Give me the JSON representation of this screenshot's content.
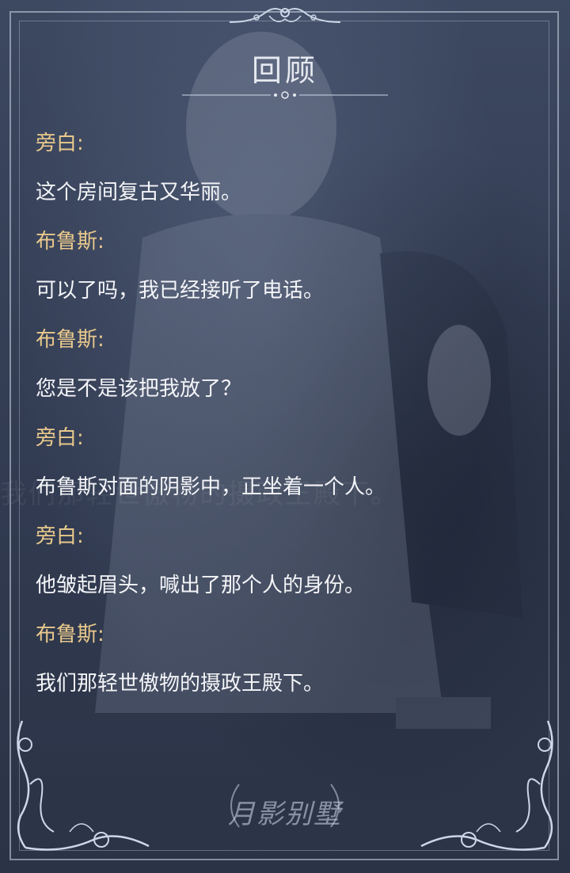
{
  "screen": {
    "title": "回顾"
  },
  "log": [
    {
      "speaker": "旁白:",
      "line": "这个房间复古又华丽。"
    },
    {
      "speaker": "布鲁斯:",
      "line": "可以了吗，我已经接听了电话。"
    },
    {
      "speaker": "布鲁斯:",
      "line": "您是不是该把我放了？"
    },
    {
      "speaker": "旁白:",
      "line": "布鲁斯对面的阴影中，正坐着一个人。"
    },
    {
      "speaker": "旁白:",
      "line": "他皱起眉头，喊出了那个人的身份。"
    },
    {
      "speaker": "布鲁斯:",
      "line": "我们那轻世傲物的摄政王殿下。"
    }
  ],
  "background": {
    "ghost_text": "我们那轻世傲物的摄政王殿下。"
  },
  "branding": {
    "logo_text": "月影别墅"
  },
  "colors": {
    "speaker": "#e9c98c",
    "dialogue": "#f4f5f8",
    "title": "#e6e9f0",
    "frame": "#cdd7e8",
    "panel": "#343e55"
  }
}
